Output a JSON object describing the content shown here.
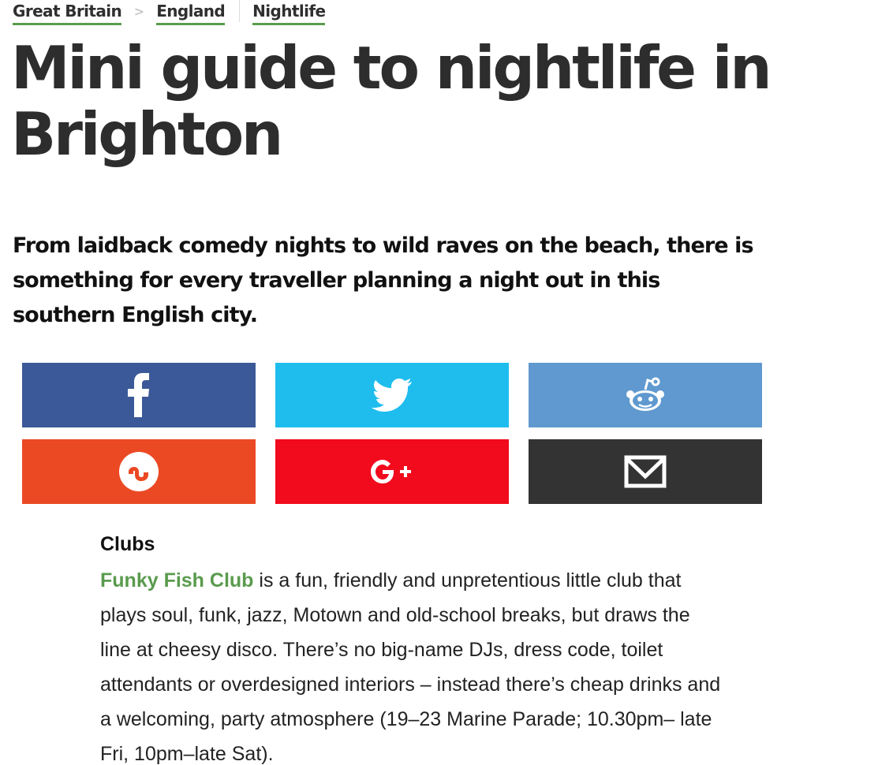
{
  "breadcrumb": {
    "items": [
      "Great Britain",
      "England",
      "Nightlife"
    ],
    "separator": ">"
  },
  "article": {
    "title": "Mini guide to nightlife in Brighton",
    "standfirst": "From laidback comedy nights to wild raves on the beach, there is something for every traveller planning a night out in this southern English city.",
    "section_heading": "Clubs",
    "body_link": "Funky Fish Club",
    "body_text": " is a fun, friendly and unpretentious little club that plays soul, funk, jazz, Motown and old-school breaks, but draws the line at cheesy disco. There’s no big-name DJs, dress code, toilet attendants or overdesigned interiors – instead there’s cheap drinks and a welcoming, party atmosphere (19–23 Marine Parade; 10.30pm– late Fri, 10pm–late Sat)."
  },
  "share": {
    "buttons": [
      {
        "icon": "facebook-icon",
        "color": "#3b5998"
      },
      {
        "icon": "twitter-icon",
        "color": "#1fbdee"
      },
      {
        "icon": "reddit-icon",
        "color": "#5f99cf"
      },
      {
        "icon": "stumbleupon-icon",
        "color": "#eb4924"
      },
      {
        "icon": "google-plus-icon",
        "color": "#f10b1d"
      },
      {
        "icon": "email-icon",
        "color": "#333333"
      }
    ]
  },
  "colors": {
    "accent_green": "#5a9b4e",
    "title_text": "#2d2d2d"
  }
}
